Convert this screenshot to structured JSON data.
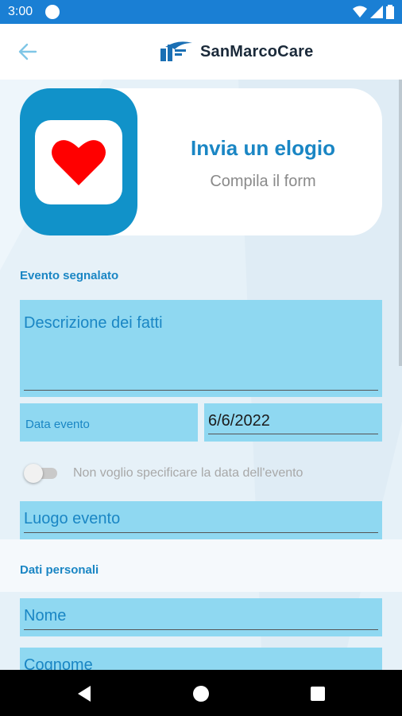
{
  "status_bar": {
    "time": "3:00"
  },
  "app_bar": {
    "brand_name": "SanMarcoCare"
  },
  "hero": {
    "title": "Invia un elogio",
    "subtitle": "Compila il form"
  },
  "sections": {
    "event": "Evento segnalato",
    "personal": "Dati personali"
  },
  "fields": {
    "description": {
      "placeholder": "Descrizione dei fatti"
    },
    "event_date": {
      "label": "Data evento",
      "value": "6/6/2022"
    },
    "no_date_toggle": {
      "label": "Non voglio specificare la data dell'evento",
      "checked": false
    },
    "location": {
      "placeholder": "Luogo evento"
    },
    "first_name": {
      "placeholder": "Nome"
    },
    "last_name": {
      "placeholder": "Cognome"
    }
  },
  "colors": {
    "status_bar": "#1a7fd4",
    "accent": "#1a86c4",
    "field_bg": "#8fd8f1",
    "hero_tile": "#1192c9",
    "heart": "#ff0000"
  },
  "icons": {
    "back": "arrow-left-icon",
    "brand": "sanmarco-logo-icon",
    "hero": "heart-icon",
    "nav_back": "triangle-back-icon",
    "nav_home": "circle-home-icon",
    "nav_recents": "square-recents-icon"
  }
}
